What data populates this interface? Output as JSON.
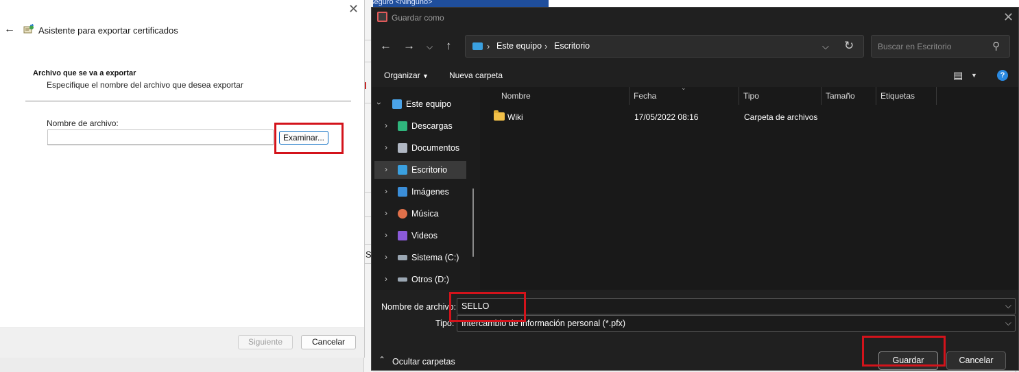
{
  "background": {
    "partial_text": "seguro          <Ninguno>",
    "fragment_letter": "S"
  },
  "wizard": {
    "title": "Asistente para exportar certificados",
    "section_title": "Archivo que se va a exportar",
    "section_desc": "Especifique el nombre del archivo que desea exportar",
    "filename_label": "Nombre de archivo:",
    "filename_value": "",
    "browse_label": "Examinar...",
    "next_label": "Siguiente",
    "cancel_label": "Cancelar",
    "back_icon": "back-arrow-icon",
    "close_icon": "close-icon"
  },
  "dialog": {
    "title": "Guardar como",
    "address": {
      "segments": [
        "Este equipo",
        "Escritorio"
      ]
    },
    "search_placeholder": "Buscar en Escritorio",
    "commands": {
      "organize": "Organizar",
      "new_folder": "Nueva carpeta"
    },
    "nav_items": [
      {
        "label": "Este equipo",
        "icon": "computer-icon",
        "color": "#4aa3e8",
        "expanded": true
      },
      {
        "label": "Descargas",
        "icon": "download-icon",
        "color": "#2fb57c"
      },
      {
        "label": "Documentos",
        "icon": "document-icon",
        "color": "#b0b7c3"
      },
      {
        "label": "Escritorio",
        "icon": "desktop-icon",
        "color": "#3aa0e0",
        "selected": true
      },
      {
        "label": "Imágenes",
        "icon": "pictures-icon",
        "color": "#3b8ed8"
      },
      {
        "label": "Música",
        "icon": "music-icon",
        "color": "#e0704a"
      },
      {
        "label": "Videos",
        "icon": "videos-icon",
        "color": "#8a5ad8"
      },
      {
        "label": "Sistema (C:)",
        "icon": "drive-c-icon",
        "color": "#9aa6b2"
      },
      {
        "label": "Otros (D:)",
        "icon": "drive-d-icon",
        "color": "#9aa6b2"
      }
    ],
    "columns": [
      "Nombre",
      "Fecha",
      "Tipo",
      "Tamaño",
      "Etiquetas"
    ],
    "files": [
      {
        "name": "Wiki",
        "date": "17/05/2022 08:16",
        "type": "Carpeta de archivos",
        "size": "",
        "tags": ""
      }
    ],
    "filename_label": "Nombre de archivo:",
    "filename_value": "SELLO",
    "type_label": "Tipo:",
    "type_value": "Intercambio de información personal (*.pfx)",
    "hide_folders_label": "Ocultar carpetas",
    "save_label": "Guardar",
    "cancel_label": "Cancelar"
  },
  "colors": {
    "highlight_red": "#d3131b",
    "dialog_bg": "#202020",
    "accent_blue": "#0067c0"
  }
}
